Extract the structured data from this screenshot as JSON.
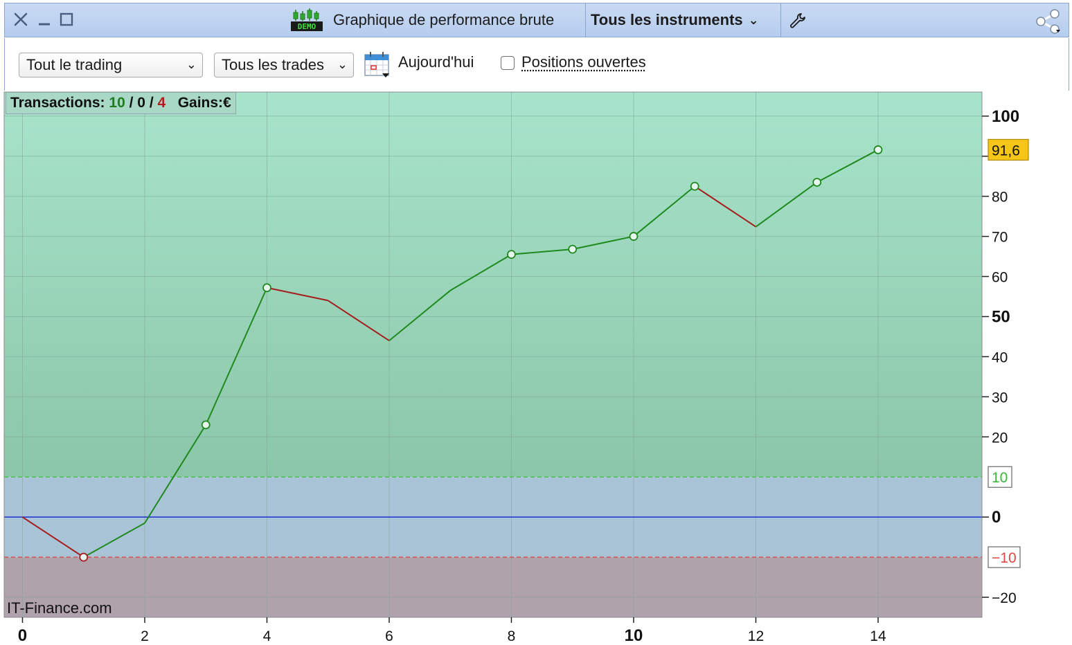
{
  "window": {
    "title": "Graphique de performance brute",
    "instrument_selector": "Tous les instruments"
  },
  "toolbar": {
    "scope_select": "Tout le trading",
    "trades_select": "Tous les trades",
    "date_label": "Aujourd'hui",
    "open_positions_label": "Positions ouvertes",
    "open_positions_checked": false
  },
  "stats": {
    "label": "Transactions:",
    "wins": "10",
    "sep1": "/",
    "neutral": "0",
    "sep2": "/",
    "losses": "4",
    "gains_label": "Gains:",
    "gains_unit": "€"
  },
  "watermark": "IT-Finance.com",
  "colors": {
    "up_line": "#1e8a1e",
    "down_line": "#a51c1c",
    "zero_line": "#1c2fd4",
    "upper_band": "#4ac44a",
    "lower_band": "#e05050",
    "last_value_bg": "#f5c518"
  },
  "chart_data": {
    "type": "line",
    "x": [
      0,
      1,
      2,
      3,
      4,
      5,
      6,
      7,
      8,
      9,
      10,
      11,
      12,
      13,
      14
    ],
    "values": [
      0,
      -10,
      -1.5,
      23,
      57.2,
      54,
      44,
      56.5,
      65.5,
      66.8,
      70,
      82.5,
      72.4,
      83.5,
      91.6
    ],
    "markers": [
      1,
      3,
      4,
      8,
      9,
      10,
      11,
      13,
      14
    ],
    "x_ticks": [
      "0",
      "2",
      "4",
      "6",
      "8",
      "10",
      "12",
      "14"
    ],
    "y_ticks": [
      "100",
      "80",
      "70",
      "60",
      "50",
      "40",
      "30",
      "20",
      "0",
      "-20"
    ],
    "xlim": [
      -0.3,
      15.7
    ],
    "ylim": [
      -25,
      106
    ],
    "upper_threshold": 10,
    "lower_threshold": -10,
    "upper_threshold_label": "10",
    "lower_threshold_label": "-10",
    "last_value_label": "91,6",
    "grid": true
  }
}
